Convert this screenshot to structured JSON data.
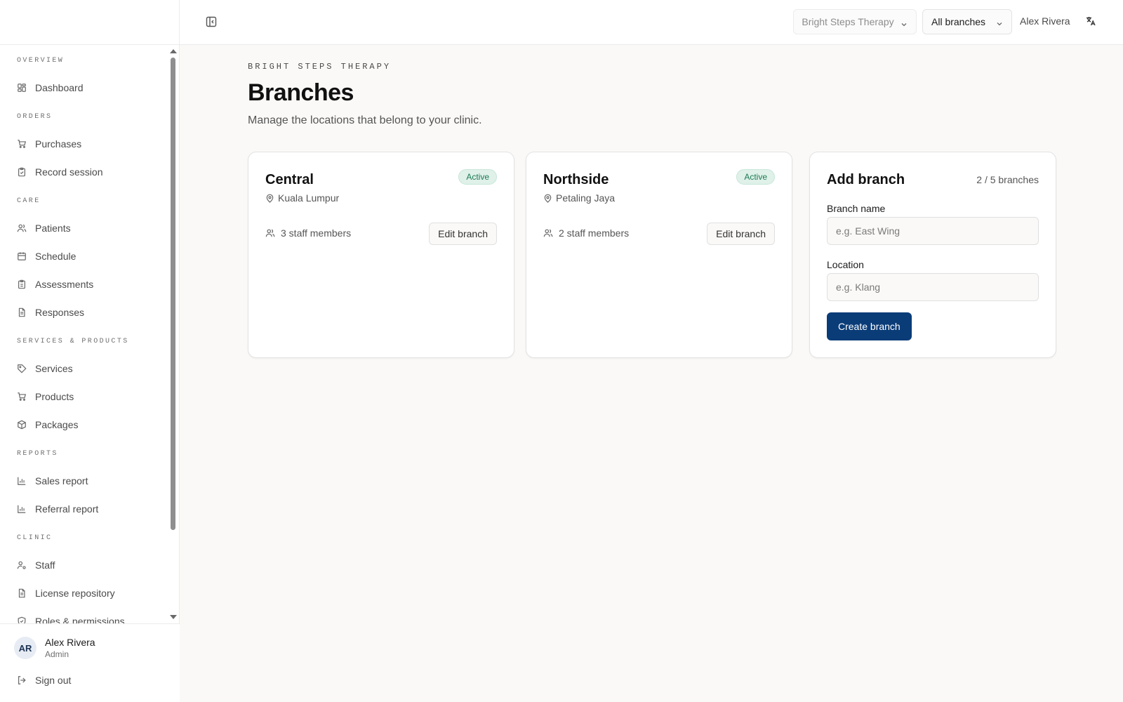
{
  "topbar": {
    "clinic_select": "Bright Steps Therapy",
    "branch_select": "All branches",
    "user_name": "Alex Rivera"
  },
  "sidebar": {
    "sections": [
      {
        "title": "OVERVIEW",
        "items": [
          {
            "label": "Dashboard",
            "icon": "dashboard-icon"
          }
        ]
      },
      {
        "title": "ORDERS",
        "items": [
          {
            "label": "Purchases",
            "icon": "cart-icon"
          },
          {
            "label": "Record session",
            "icon": "clipboard-icon"
          }
        ]
      },
      {
        "title": "CARE",
        "items": [
          {
            "label": "Patients",
            "icon": "users-icon"
          },
          {
            "label": "Schedule",
            "icon": "calendar-icon"
          },
          {
            "label": "Assessments",
            "icon": "clipboard-list-icon"
          },
          {
            "label": "Responses",
            "icon": "file-text-icon"
          }
        ]
      },
      {
        "title": "SERVICES & PRODUCTS",
        "items": [
          {
            "label": "Services",
            "icon": "tag-icon"
          },
          {
            "label": "Products",
            "icon": "cart-icon"
          },
          {
            "label": "Packages",
            "icon": "package-icon"
          }
        ]
      },
      {
        "title": "REPORTS",
        "items": [
          {
            "label": "Sales report",
            "icon": "bar-chart-icon"
          },
          {
            "label": "Referral report",
            "icon": "bar-chart-icon"
          }
        ]
      },
      {
        "title": "CLINIC",
        "items": [
          {
            "label": "Staff",
            "icon": "user-cog-icon"
          },
          {
            "label": "License repository",
            "icon": "file-text-icon"
          },
          {
            "label": "Roles & permissions",
            "icon": "shield-icon"
          }
        ]
      }
    ],
    "user": {
      "initials": "AR",
      "name": "Alex Rivera",
      "role": "Admin"
    },
    "sign_out": "Sign out"
  },
  "main": {
    "eyebrow": "BRIGHT STEPS THERAPY",
    "title": "Branches",
    "subtitle": "Manage the locations that belong to your clinic.",
    "branches": [
      {
        "name": "Central",
        "status": "Active",
        "location": "Kuala Lumpur",
        "staff": "3 staff members",
        "edit_label": "Edit branch"
      },
      {
        "name": "Northside",
        "status": "Active",
        "location": "Petaling Jaya",
        "staff": "2 staff members",
        "edit_label": "Edit branch"
      }
    ],
    "add_branch": {
      "title": "Add branch",
      "count": "2 / 5 branches",
      "name_label": "Branch name",
      "name_placeholder": "e.g. East Wing",
      "location_label": "Location",
      "location_placeholder": "e.g. Klang",
      "submit_label": "Create branch"
    }
  },
  "colors": {
    "primary": "#0a3c78",
    "active_badge_bg": "#dff1e9",
    "active_badge_text": "#1e7a55",
    "page_bg": "#faf9f7"
  }
}
